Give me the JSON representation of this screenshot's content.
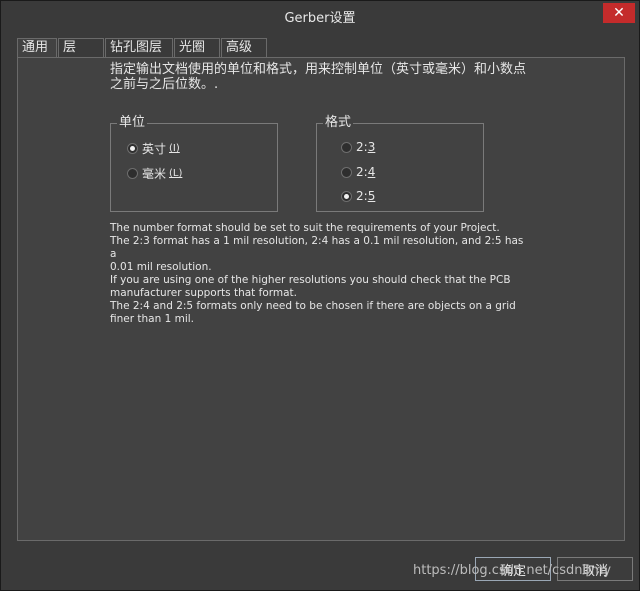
{
  "window": {
    "title": "Gerber设置",
    "close_glyph": "✕"
  },
  "tabs": [
    {
      "label": "通用",
      "active": true
    },
    {
      "label": "层",
      "active": false
    },
    {
      "label": "钻孔图层",
      "active": false
    },
    {
      "label": "光圈",
      "active": false
    },
    {
      "label": "高级",
      "active": false
    }
  ],
  "general": {
    "intro_line1": "指定输出文档使用的单位和格式，用来控制单位（英寸或毫米）和小数点",
    "intro_line2": "之前与之后位数。.",
    "units_group": {
      "title": "单位",
      "options": [
        {
          "label": "英寸",
          "accel": "(I)",
          "selected": true
        },
        {
          "label": "毫米",
          "accel": "(L)",
          "selected": false
        }
      ]
    },
    "format_group": {
      "title": "格式",
      "options": [
        {
          "prefix": "2:",
          "accel": "3",
          "selected": false
        },
        {
          "prefix": "2:",
          "accel": "4",
          "selected": false
        },
        {
          "prefix": "2:",
          "accel": "5",
          "selected": true
        }
      ]
    },
    "description": [
      "The number format should be set to suit the requirements of your Project.",
      "The 2:3 format has a 1 mil resolution, 2:4 has a 0.1 mil resolution, and 2:5 has a",
      "0.01 mil resolution.",
      "If you are using one of the higher resolutions you should check that the PCB",
      "manufacturer supports that format.",
      "The 2:4 and 2:5 formats only need to be chosen if there are objects on a grid",
      "finer than 1 mil."
    ]
  },
  "buttons": {
    "ok": "确定",
    "cancel": "取消"
  },
  "watermark": "https://blog.csdn.net/csdnbmy"
}
